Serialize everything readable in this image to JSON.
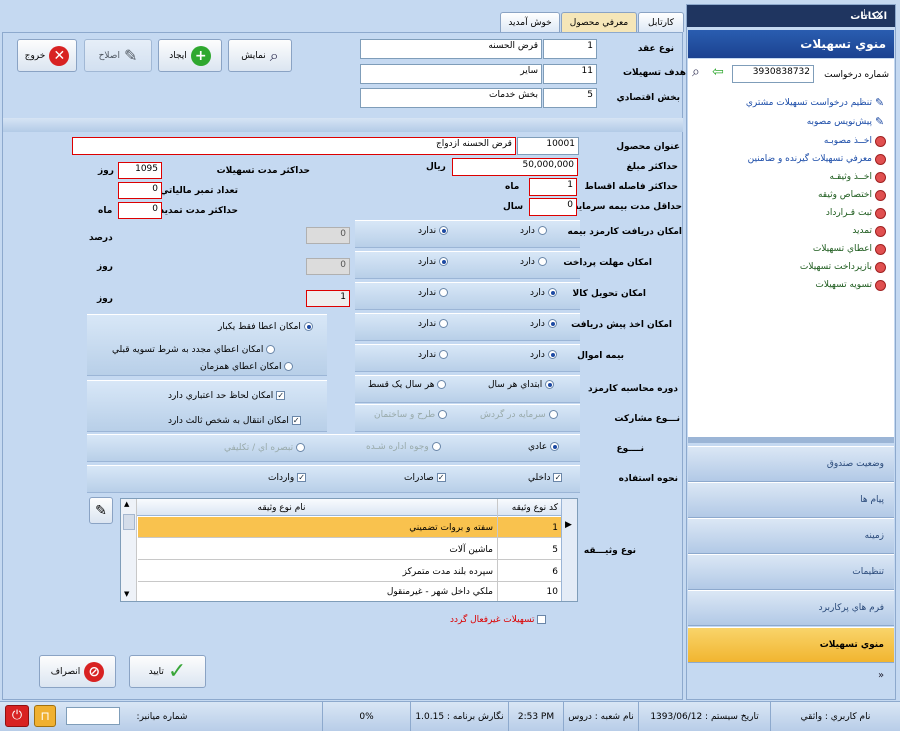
{
  "tabs": [
    "کارتابل",
    "معرفي محصول",
    "خوش آمديد"
  ],
  "toolbar": {
    "exit": "خروج",
    "edit": "اصلاح",
    "create": "ايجاد",
    "show": "نمايش"
  },
  "header_fields": [
    {
      "label": "نوع عقد",
      "code": "1",
      "value": "قرض الحسنه"
    },
    {
      "label": "هدف تسهيلات",
      "code": "11",
      "value": "ساير"
    },
    {
      "label": "بخش اقتصادي",
      "code": "5",
      "value": "بخش خدمات"
    }
  ],
  "product": {
    "label": "عنوان محصول",
    "code": "10001",
    "value": "قرض الحسنه ازدواج"
  },
  "amounts": {
    "max_amount_label": "حداكثر مبلغ",
    "max_amount": "50,000,000",
    "currency": "ريال",
    "installment_gap_label": "حداكثر فاصله اقساط",
    "installment_gap": "1",
    "installment_gap_unit": "ماه",
    "min_insurance_label": "حداقل مدت بيمه سرمايه",
    "min_insurance": "0",
    "min_insurance_unit": "سال",
    "max_duration_label": "حداكثر مدت تسهيلات",
    "max_duration": "1095",
    "max_duration_unit": "روز",
    "stamps_label": "تعداد تمبر مالياتي",
    "stamps": "0",
    "extension_label": "حداكثر مدت تمديد",
    "extension": "0",
    "extension_unit": "ماه"
  },
  "options": [
    {
      "label": "امكان دريافت كارمزد بيمه",
      "yes": "دارد",
      "no": "ندارد",
      "selected": "no",
      "side_value": "0",
      "side_unit": "درصد"
    },
    {
      "label": "امكان مهلت پرداخت",
      "yes": "دارد",
      "no": "ندارد",
      "selected": "no",
      "side_value": "0",
      "side_unit": "روز"
    },
    {
      "label": "امكان تحويل كالا",
      "yes": "دارد",
      "no": "ندارد",
      "selected": "yes",
      "side_value": "1",
      "side_unit": "روز"
    },
    {
      "label": "امكان اخذ پيش دريافت",
      "yes": "دارد",
      "no": "ندارد",
      "selected": "yes"
    },
    {
      "label": "بيمه اموال",
      "yes": "دارد",
      "no": "ندارد",
      "selected": "yes"
    }
  ],
  "grant_options": [
    "امكان اعطا فقط يكبار",
    "امكان اعطاي مجدد به شرط تسويه قبلي",
    "امكان اعطاي همزمان"
  ],
  "commission": {
    "label": "دوره محاسبه كارمزد",
    "a": "ابتداي هر سال",
    "b": "هر سال يک قسط"
  },
  "partnership": {
    "label": "نـــوع مشاركت",
    "a": "سرمايه در گردش",
    "b": "طرح و ساختمان"
  },
  "credit_checks": [
    "امكان لحاظ حد اعتباري دارد",
    "امكان انتقال به شخص  ثالث دارد"
  ],
  "type": {
    "label": "نــــوع",
    "a": "عادي",
    "b": "وجوه اداره شـده",
    "c": "تبصره اي / تكليفي"
  },
  "usage": {
    "label": "نحوه استفاده",
    "a": "داخلي",
    "b": "صادرات",
    "c": "واردات"
  },
  "collateral": {
    "label": "نوع وثيـــقه",
    "headers": [
      "كد نوع وثيقه",
      "نام نوع وثيقه"
    ],
    "rows": [
      [
        "1",
        "سفته و بروات تضميني"
      ],
      [
        "5",
        "ماشين آلات"
      ],
      [
        "6",
        "سپرده بلند مدت متمركز"
      ],
      [
        "10",
        "ملكي داخل شهر - غيرمنقول"
      ]
    ]
  },
  "inactive_label": "تسهيلات غيرفعال گردد",
  "actions": {
    "confirm": "تاييد",
    "cancel": "انصراف"
  },
  "right_panel": {
    "title": "امكانات",
    "menu_title": "منوي تسهيلات",
    "request_label": "شماره درخواست",
    "request_no": "3930838732",
    "items": [
      {
        "label": "تنظيم درخواست تسهيلات مشتري",
        "icon": "pencil-icon"
      },
      {
        "label": "پيش‌نويس مصوبه",
        "icon": "pencil-icon"
      },
      {
        "label": "اخــذ مصوبـه",
        "icon": "stop-icon"
      },
      {
        "label": "معرفي تسهيلات گيرنده و ضامنين",
        "icon": "stop-icon"
      },
      {
        "label": "اخــذ وثيقـه",
        "icon": "stop-icon"
      },
      {
        "label": "اختصاص وثيقه",
        "icon": "stop-icon"
      },
      {
        "label": "ثبت قـرارداد",
        "icon": "stop-icon"
      },
      {
        "label": "تمديد",
        "icon": "stop-icon"
      },
      {
        "label": "اعطاي تسهيلات",
        "icon": "stop-icon"
      },
      {
        "label": "بازپرداخت تسهيلات",
        "icon": "stop-icon"
      },
      {
        "label": "تسويه تسهيلات",
        "icon": "stop-icon"
      }
    ],
    "sections": [
      "وضعيت صندوق",
      "پيام ها",
      "زمينه",
      "تنظيمات",
      "فرم هاي پركاربرد",
      "منوي تسهيلات"
    ]
  },
  "status": {
    "user": "نام كاربري : واثقي",
    "date": "تاريخ سيستم :   1393/06/12",
    "branch": "نام شعبه : دروس",
    "time": "2:53 PM",
    "version": "نگارش برنامه : 1.0.15",
    "percent": "0%",
    "shortcut_label": "شماره ميانبر:"
  }
}
